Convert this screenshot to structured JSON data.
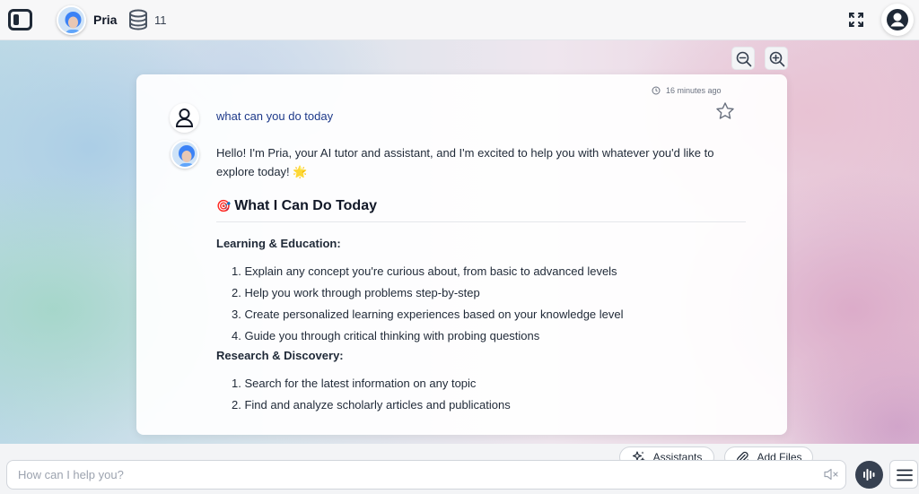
{
  "header": {
    "assistant_name": "Pria",
    "credits": "11"
  },
  "message": {
    "timestamp": "16 minutes ago",
    "user_text": "what can you do today",
    "reply_intro": "Hello! I'm Pria, your AI tutor and assistant, and I'm excited to help you with whatever you'd like to explore today! 🌟",
    "heading_emoji": "🎯",
    "heading": "What I Can Do Today",
    "sections": [
      {
        "title": "Learning & Education:",
        "items": [
          "1. Explain any concept you're curious about, from basic to advanced levels",
          "2. Help you work through problems step-by-step",
          "3. Create personalized learning experiences based on your knowledge level",
          "4. Guide you through critical thinking with probing questions"
        ]
      },
      {
        "title": "Research & Discovery:",
        "items": [
          "1. Search for the latest information on any topic",
          "2. Find and analyze scholarly articles and publications"
        ]
      }
    ]
  },
  "composer": {
    "assistants_label": "Assistants",
    "add_files_label": "Add Files",
    "placeholder": "How can I help you?"
  },
  "icons": {
    "sidebar": "sidebar-toggle-icon",
    "credits": "database-icon",
    "fullscreen": "expand-icon",
    "account": "user-circle-icon",
    "zoom_out": "zoom-out-icon",
    "zoom_in": "zoom-in-icon",
    "star": "star-icon",
    "clock": "clock-icon",
    "sparkles": "sparkles-icon",
    "paperclip": "paperclip-icon",
    "mute": "speaker-mute-icon",
    "voice": "waveform-icon",
    "menu": "hamburger-icon"
  },
  "colors": {
    "user_text": "#1e3a8a",
    "voice_button": "#374151"
  }
}
